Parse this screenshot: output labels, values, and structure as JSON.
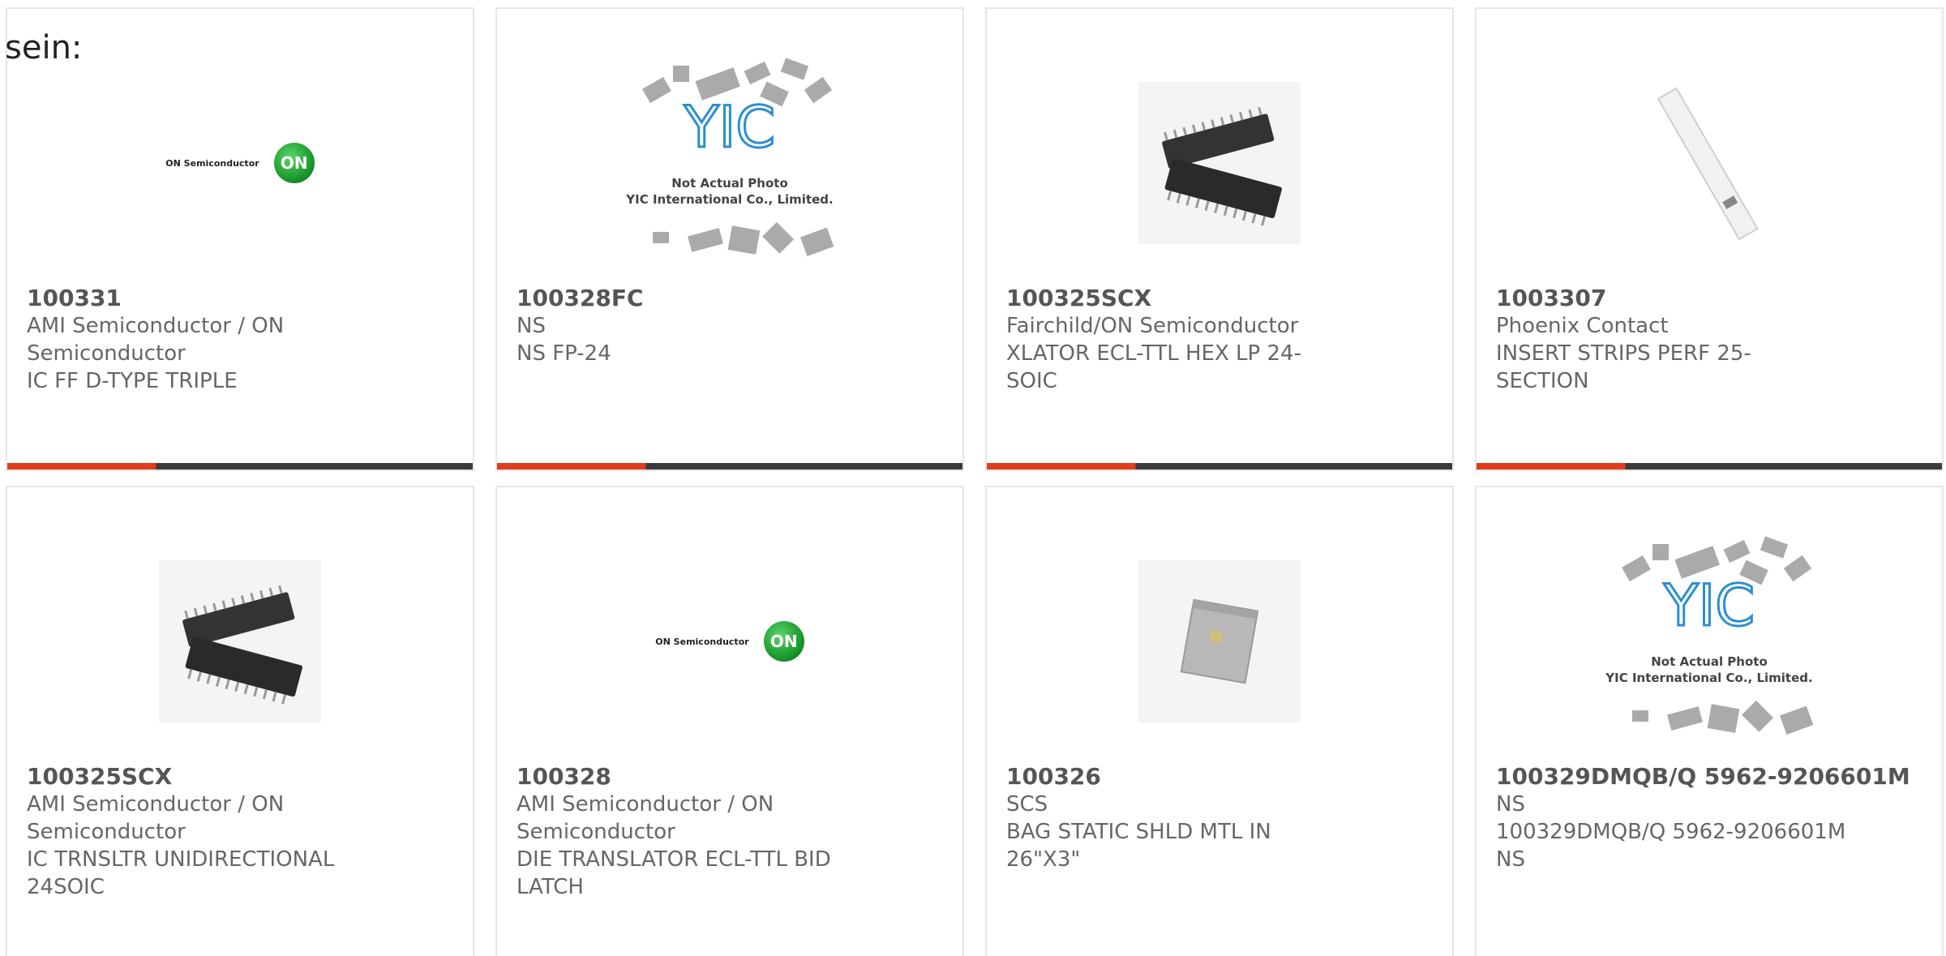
{
  "page_label": "sein:",
  "colors": {
    "accent": "#e13d1d",
    "bar_dark": "#3b3b3b",
    "text": "#666666"
  },
  "products": [
    {
      "part": "100331",
      "manufacturer": "AMI Semiconductor / ON Semiconductor",
      "description": "IC FF D-TYPE TRIPLE",
      "image": "on-semiconductor-logo",
      "logo_text": "ON Semiconductor",
      "logo_badge": "ON"
    },
    {
      "part": "100328FC",
      "manufacturer": "NS",
      "description": "NS FP-24",
      "image": "yic-placeholder",
      "placeholder_line1": "Not Actual Photo",
      "placeholder_line2": "YIC International Co., Limited."
    },
    {
      "part": "100325SCX",
      "manufacturer": "Fairchild/ON Semiconductor",
      "description": "XLATOR ECL-TTL HEX LP 24-SOIC",
      "image": "soic-chip-photo"
    },
    {
      "part": "1003307",
      "manufacturer": "Phoenix Contact",
      "description": "INSERT STRIPS PERF 25-SECTION",
      "image": "insert-strip-photo"
    },
    {
      "part": "100325SCX",
      "manufacturer": "AMI Semiconductor / ON Semiconductor",
      "description": "IC TRNSLTR UNIDIRECTIONAL 24SOIC",
      "image": "soic-chip-photo"
    },
    {
      "part": "100328",
      "manufacturer": "AMI Semiconductor / ON Semiconductor",
      "description": "DIE TRANSLATOR ECL-TTL BID LATCH",
      "image": "on-semiconductor-logo",
      "logo_text": "ON Semiconductor",
      "logo_badge": "ON"
    },
    {
      "part": "100326",
      "manufacturer": "SCS",
      "description": "BAG STATIC SHLD MTL IN 26\"X3\"",
      "image": "static-bag-photo"
    },
    {
      "part": "100329DMQB/Q 5962-9206601M",
      "manufacturer": "NS",
      "description": "100329DMQB/Q 5962-9206601M",
      "extra": "NS",
      "image": "yic-placeholder",
      "placeholder_line1": "Not Actual Photo",
      "placeholder_line2": "YIC International Co., Limited."
    }
  ]
}
